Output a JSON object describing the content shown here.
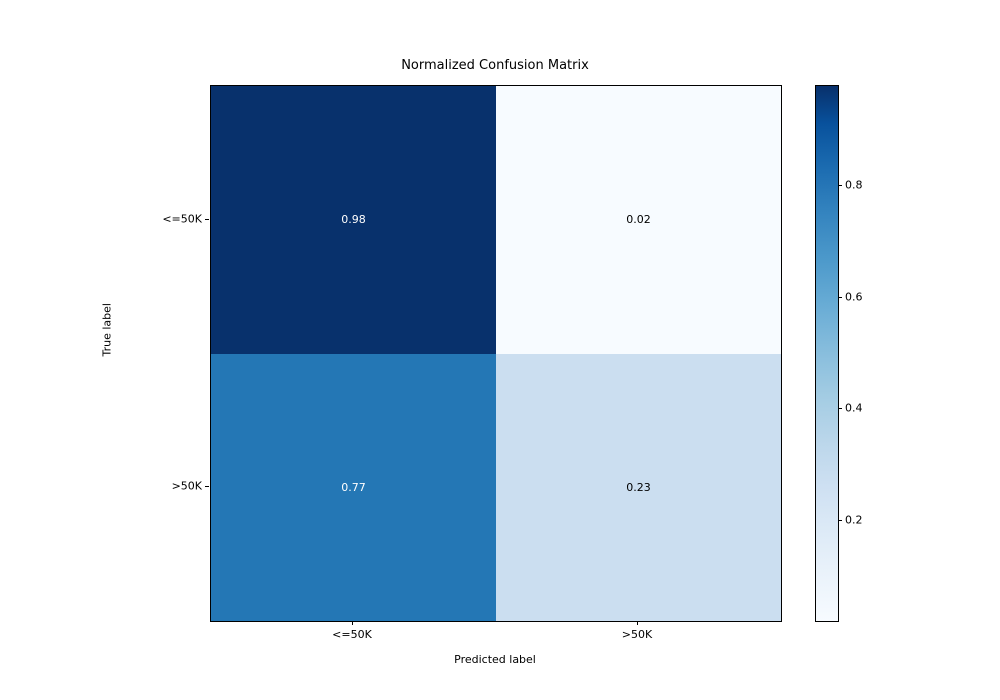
{
  "chart_data": {
    "type": "heatmap",
    "title": "Normalized Confusion Matrix",
    "xlabel": "Predicted label",
    "ylabel": "True label",
    "x_categories": [
      "<=50K",
      ">50K"
    ],
    "y_categories": [
      "<=50K",
      ">50K"
    ],
    "matrix": [
      [
        0.98,
        0.02
      ],
      [
        0.77,
        0.23
      ]
    ],
    "cell_labels": [
      [
        "0.98",
        "0.02"
      ],
      [
        "0.77",
        "0.23"
      ]
    ],
    "colorbar_ticks": [
      "0.2",
      "0.4",
      "0.6",
      "0.8"
    ],
    "vmin": 0.02,
    "vmax": 0.98,
    "colormap": "Blues"
  }
}
